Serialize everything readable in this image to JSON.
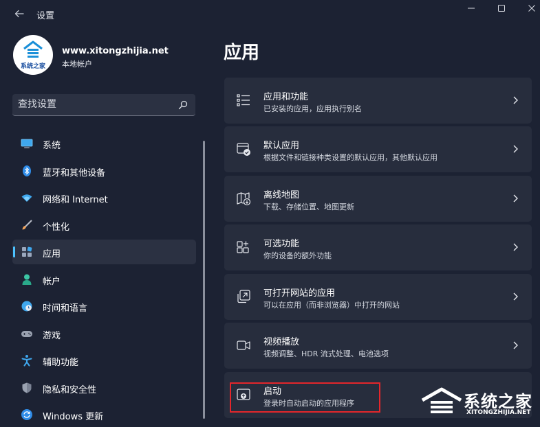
{
  "window": {
    "title": "设置"
  },
  "profile": {
    "name": "www.xitongzhijia.net",
    "account_type": "本地帐户",
    "avatar_text": "系统之家"
  },
  "search": {
    "placeholder": "查找设置"
  },
  "sidebar": {
    "items": [
      {
        "label": "系统",
        "icon": "monitor-icon",
        "active": false
      },
      {
        "label": "蓝牙和其他设备",
        "icon": "bluetooth-icon",
        "active": false
      },
      {
        "label": "网络和 Internet",
        "icon": "wifi-icon",
        "active": false
      },
      {
        "label": "个性化",
        "icon": "brush-icon",
        "active": false
      },
      {
        "label": "应用",
        "icon": "apps-icon",
        "active": true
      },
      {
        "label": "帐户",
        "icon": "person-icon",
        "active": false
      },
      {
        "label": "时间和语言",
        "icon": "globe-clock-icon",
        "active": false
      },
      {
        "label": "游戏",
        "icon": "gamepad-icon",
        "active": false
      },
      {
        "label": "辅助功能",
        "icon": "accessibility-icon",
        "active": false
      },
      {
        "label": "隐私和安全性",
        "icon": "shield-icon",
        "active": false
      },
      {
        "label": "Windows 更新",
        "icon": "update-icon",
        "active": false
      }
    ]
  },
  "main": {
    "title": "应用",
    "cards": [
      {
        "title": "应用和功能",
        "subtitle": "已安装的应用，应用执行别名",
        "icon": "list-icon"
      },
      {
        "title": "默认应用",
        "subtitle": "根据文件和链接种类设置的默认应用，其他默认应用",
        "icon": "default-apps-icon"
      },
      {
        "title": "离线地图",
        "subtitle": "下载、存储位置、地图更新",
        "icon": "map-icon"
      },
      {
        "title": "可选功能",
        "subtitle": "你的设备的额外功能",
        "icon": "optional-features-icon"
      },
      {
        "title": "可打开网站的应用",
        "subtitle": "可以在应用（而非浏览器）中打开的网站",
        "icon": "open-external-icon"
      },
      {
        "title": "视频播放",
        "subtitle": "视频调整、HDR 流式处理、电池选项",
        "icon": "video-icon"
      },
      {
        "title": "启动",
        "subtitle": "登录时自动启动的应用程序",
        "icon": "startup-icon"
      }
    ]
  },
  "watermark": {
    "text": "系统之家",
    "url": "XITONGZHIJIA.NET"
  },
  "colors": {
    "background": "#1c2233",
    "card": "#272d3d",
    "accent": "#4cc2ff",
    "highlight_box": "#e5262b"
  }
}
